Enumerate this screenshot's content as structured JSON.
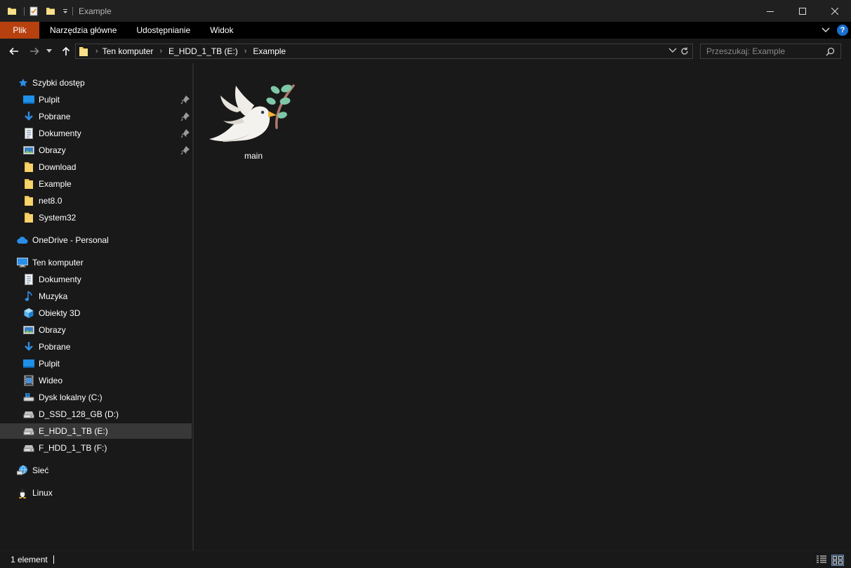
{
  "window": {
    "title": "Example",
    "controls": [
      "minimize-icon",
      "maximize-icon",
      "close-icon"
    ]
  },
  "ribbon": {
    "file_tab": "Plik",
    "tabs": [
      "Narzędzia główne",
      "Udostępnianie",
      "Widok"
    ]
  },
  "address": {
    "breadcrumbs": [
      "Ten komputer",
      "E_HDD_1_TB (E:)",
      "Example"
    ]
  },
  "search": {
    "placeholder": "Przeszukaj: Example"
  },
  "sidebar": {
    "quick_access": {
      "label": "Szybki dostęp",
      "items": [
        {
          "label": "Pulpit",
          "icon": "desktop-icon",
          "pinned": true
        },
        {
          "label": "Pobrane",
          "icon": "download-arrow-icon",
          "pinned": true
        },
        {
          "label": "Dokumenty",
          "icon": "document-icon",
          "pinned": true
        },
        {
          "label": "Obrazy",
          "icon": "pictures-icon",
          "pinned": true
        },
        {
          "label": "Download",
          "icon": "folder-icon",
          "pinned": false
        },
        {
          "label": "Example",
          "icon": "folder-icon",
          "pinned": false
        },
        {
          "label": "net8.0",
          "icon": "folder-icon",
          "pinned": false
        },
        {
          "label": "System32",
          "icon": "folder-icon",
          "pinned": false
        }
      ]
    },
    "onedrive": {
      "label": "OneDrive - Personal"
    },
    "this_pc": {
      "label": "Ten komputer",
      "items": [
        {
          "label": "Dokumenty",
          "icon": "document-icon"
        },
        {
          "label": "Muzyka",
          "icon": "music-icon"
        },
        {
          "label": "Obiekty 3D",
          "icon": "cube-3d-icon"
        },
        {
          "label": "Obrazy",
          "icon": "pictures-icon"
        },
        {
          "label": "Pobrane",
          "icon": "download-arrow-icon"
        },
        {
          "label": "Pulpit",
          "icon": "desktop-icon"
        },
        {
          "label": "Wideo",
          "icon": "video-icon"
        },
        {
          "label": "Dysk lokalny (C:)",
          "icon": "drive-icon"
        },
        {
          "label": "D_SSD_128_GB (D:)",
          "icon": "drive-icon"
        },
        {
          "label": "E_HDD_1_TB (E:)",
          "icon": "drive-icon",
          "selected": true
        },
        {
          "label": "F_HDD_1_TB (F:)",
          "icon": "drive-icon"
        }
      ]
    },
    "network": {
      "label": "Sieć"
    },
    "linux": {
      "label": "Linux"
    }
  },
  "content": {
    "files": [
      {
        "name": "main",
        "icon": "dove-with-olive-branch-icon"
      }
    ]
  },
  "status": {
    "count": "1 element"
  },
  "colors": {
    "file_tab": "#b7410e",
    "selection": "#383838",
    "folder": "#f6d36b",
    "accent_blue": "#1a6fcf"
  }
}
